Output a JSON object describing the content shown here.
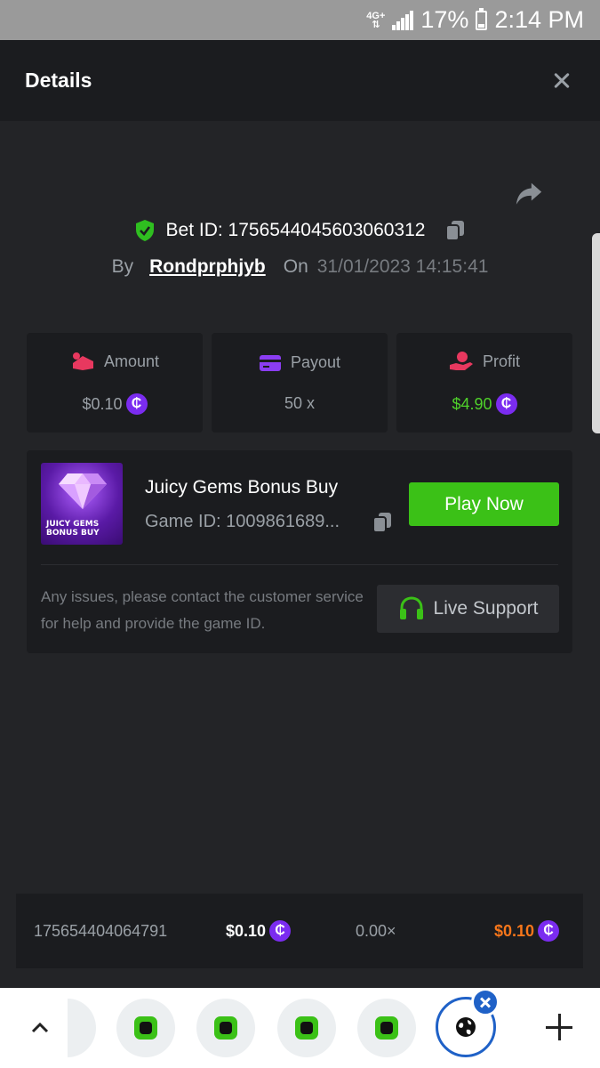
{
  "status_bar": {
    "network": "4G+",
    "battery": "17%",
    "time": "2:14 PM"
  },
  "header": {
    "title": "Details"
  },
  "bet": {
    "bet_id_text": "Bet ID: 1756544045603060312",
    "by_label": "By",
    "username": "Rondprphjyb",
    "on_label": "On",
    "datetime": "31/01/2023 14:15:41"
  },
  "stats": [
    {
      "label": "Amount",
      "value": "$0.10",
      "color": "#9aa0a6",
      "icon": "coins-icon"
    },
    {
      "label": "Payout",
      "value": "50 x",
      "color": "#9aa0a6",
      "icon": "card-icon"
    },
    {
      "label": "Profit",
      "value": "$4.90",
      "color": "#4fd12a",
      "icon": "hand-coin-icon"
    }
  ],
  "game": {
    "thumb_line1": "JUICY GEMS",
    "thumb_line2": "BONUS BUY",
    "title": "Juicy Gems Bonus Buy",
    "game_id": "Game ID: 1009861689...",
    "play_label": "Play Now",
    "issue_text": "Any issues, please contact the customer service for help and provide the game ID.",
    "support_label": "Live Support"
  },
  "list_row": {
    "id": "175654404064791",
    "amount": "$0.10",
    "multiplier": "0.00×",
    "profit": "$0.10"
  },
  "colors": {
    "accent_green": "#3bc117",
    "coin_purple": "#7b2cf0",
    "profit_orange": "#f7761a",
    "active_tab_blue": "#1f61c7"
  }
}
